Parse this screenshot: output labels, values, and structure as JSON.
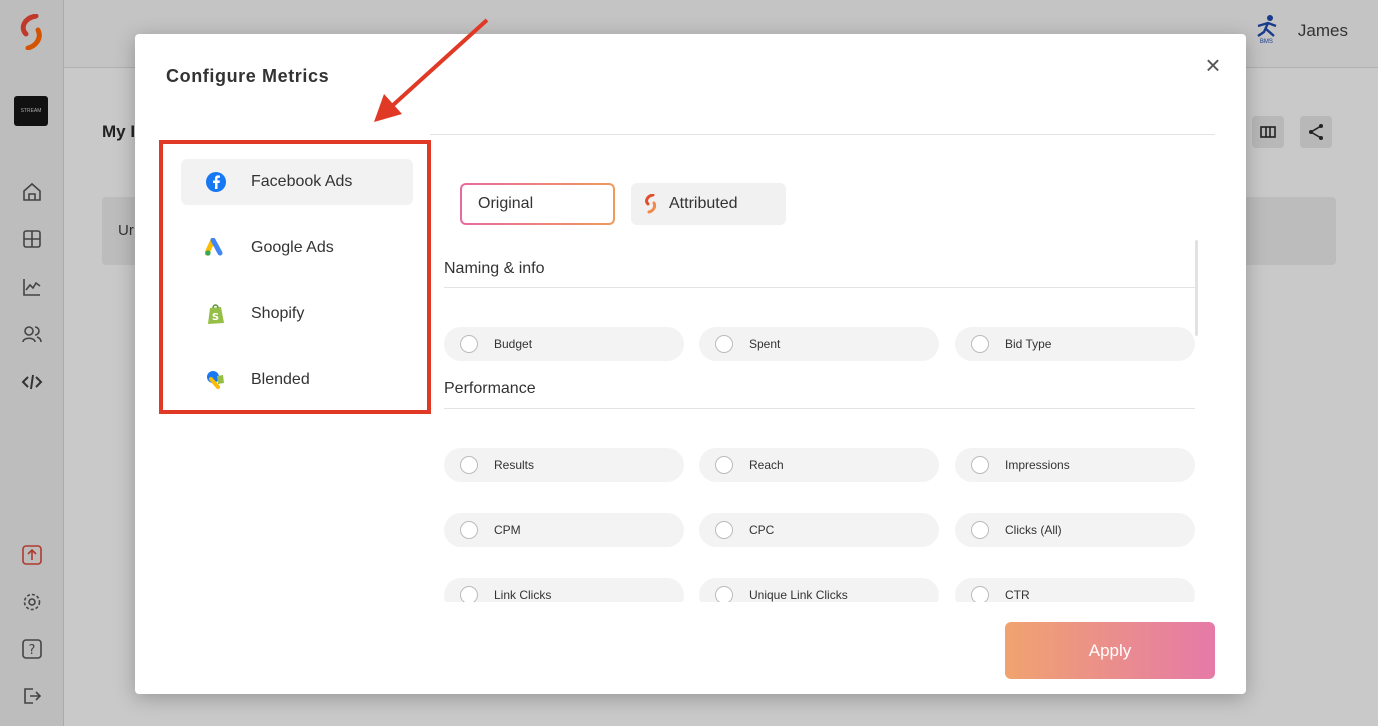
{
  "background": {
    "user_name": "James",
    "page_title_fragment": "My I",
    "card_text_fragment": "Ur",
    "brand_thumb_text": "STREAM",
    "user_logo_text": "BMS"
  },
  "modal": {
    "title": "Configure Metrics",
    "close_symbol": "×",
    "sources": [
      {
        "label": "Facebook Ads",
        "icon": "facebook-icon",
        "active": true
      },
      {
        "label": "Google Ads",
        "icon": "google-ads-icon",
        "active": false
      },
      {
        "label": "Shopify",
        "icon": "shopify-icon",
        "active": false
      },
      {
        "label": "Blended",
        "icon": "blended-icon",
        "active": false
      }
    ],
    "toggles": {
      "original": "Original",
      "attributed": "Attributed"
    },
    "sections": [
      {
        "title": "Naming & info",
        "metrics": [
          "Budget",
          "Spent",
          "Bid Type"
        ]
      },
      {
        "title": "Performance",
        "metrics": [
          "Results",
          "Reach",
          "Impressions",
          "CPM",
          "CPC",
          "Clicks (All)",
          "Link Clicks",
          "Unique Link Clicks",
          "CTR"
        ]
      }
    ],
    "apply_label": "Apply"
  },
  "colors": {
    "annotation_red": "#e03a26",
    "gradient_start": "#f0a36f",
    "gradient_end": "#e57aa8",
    "facebook_blue": "#1877f2"
  }
}
